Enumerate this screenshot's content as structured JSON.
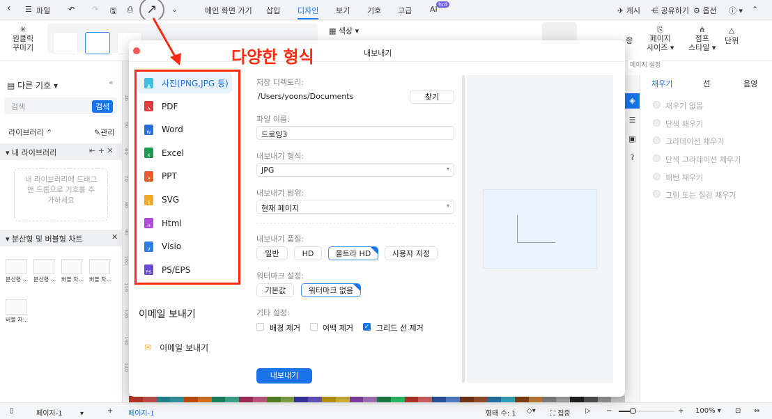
{
  "topbar": {
    "file": "파일",
    "menus": [
      "메인 화면 가기",
      "삽입",
      "디자인",
      "보기",
      "기호",
      "고급",
      "AI"
    ],
    "hot_badge": "hot",
    "publish": "게시",
    "share": "공유하기",
    "options": "옵션"
  },
  "ribbon": {
    "one_click": "원클릭",
    "decorate": "꾸미기",
    "color": "색상",
    "page_size_1": "페이지",
    "page_size_2": "사이즈",
    "jump_1": "점프",
    "jump_2": "스타일",
    "unit": "단위",
    "orientation": "향",
    "page_settings": "페이지 설정"
  },
  "annotation": {
    "title": "다양한 형식",
    "color": "#ff2a10"
  },
  "left_panel": {
    "title": "다른 기호",
    "search_placeholder": "검색",
    "search_button": "검색",
    "library": "라이브러리",
    "manage": "관리",
    "my_library": "내 라이브러리",
    "drop_hint": "내 라이브러리에 드래그 앤 드롭으로 기호를 추가하세요",
    "category": "분산형 및 버블형 차트",
    "thumbs": [
      "분산형 ...",
      "분산형 ...",
      "버블 차...",
      "버블 차...",
      "버블 차..."
    ]
  },
  "ruler": [
    "40",
    "50",
    "60",
    "70",
    "80",
    "90",
    "100",
    "110",
    "120",
    "130",
    "140"
  ],
  "dialog": {
    "title": "내보내기",
    "formats": [
      {
        "label": "사진(PNG,JPG 등)",
        "color": "#3ec1e0",
        "letter": "▲"
      },
      {
        "label": "PDF",
        "color": "#e23b3b",
        "letter": "A"
      },
      {
        "label": "Word",
        "color": "#2d6fd8",
        "letter": "W"
      },
      {
        "label": "Excel",
        "color": "#1e9b53",
        "letter": "X"
      },
      {
        "label": "PPT",
        "color": "#ef5a2c",
        "letter": "P"
      },
      {
        "label": "SVG",
        "color": "#f0a825",
        "letter": "S"
      },
      {
        "label": "Html",
        "color": "#b04ad8",
        "letter": "H"
      },
      {
        "label": "Visio",
        "color": "#2f7ee6",
        "letter": "V"
      },
      {
        "label": "PS/EPS",
        "color": "#6a4ad8",
        "letter": "PS"
      }
    ],
    "email_heading": "이메일 보내기",
    "email_item": "이메일 보내기",
    "dir_label": "저장 디렉토리:",
    "dir_value": "/Users/yoons/Documents",
    "browse": "찾기",
    "filename_label": "파일 이름:",
    "filename_value": "드로잉3",
    "format_label": "내보내기 형식:",
    "format_value": "JPG",
    "range_label": "내보내기 범위:",
    "range_value": "현재 페이지",
    "quality_label": "내보내기 품질:",
    "quality_options": [
      "일반",
      "HD",
      "울트라 HD",
      "사용자 지정"
    ],
    "quality_selected": "울트라 HD",
    "watermark_label": "워터마크 설정:",
    "watermark_options": [
      "기본값",
      "워터마크 없음"
    ],
    "watermark_selected": "워터마크 없음",
    "other_label": "기타 설정:",
    "checkboxes": [
      {
        "label": "배경 제거",
        "checked": false
      },
      {
        "label": "여백 제거",
        "checked": false
      },
      {
        "label": "그리드 선 제거",
        "checked": true
      }
    ],
    "export_button": "내보내기"
  },
  "right_panel": {
    "tabs": [
      "채우기",
      "선",
      "음영"
    ],
    "fill_options": [
      "채우기 없음",
      "단색 채우기",
      "그라데이션 채우기",
      "단색 그라데이션 채우기",
      "패턴 채우기",
      "그림 또는 질감 채우기"
    ]
  },
  "status": {
    "page_select": "페이지-1",
    "page_tab": "페이지-1",
    "shape_count": "형태 수: 1",
    "focus": "집중",
    "zoom": "100%"
  },
  "accent": "#1a73e8"
}
